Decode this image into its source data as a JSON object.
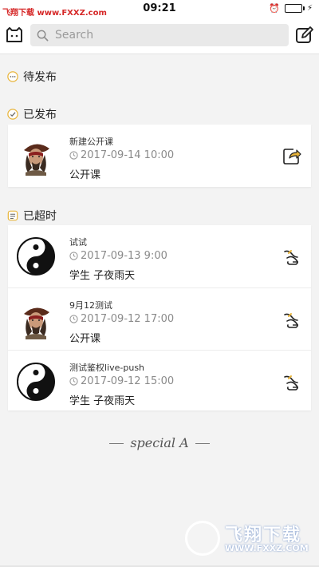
{
  "status_bar": {
    "watermark": "飞翔下载 www.FXXZ.com",
    "time": "09:21",
    "battery_percent": 100
  },
  "nav": {
    "search_placeholder": "Search",
    "left_icon": "cat-logo-icon",
    "right_icon": "compose-icon"
  },
  "sections": {
    "pending": {
      "label": "待发布",
      "icon": "pending-dots-icon"
    },
    "published": {
      "label": "已发布",
      "icon": "published-check-icon"
    },
    "expired": {
      "label": "已超时",
      "icon": "expired-list-icon"
    }
  },
  "published_items": [
    {
      "title": "新建公开课",
      "time": "2017-09-14 10:00",
      "sub": "公开课",
      "avatar": "pirate-avatar",
      "action_icon": "share-icon"
    }
  ],
  "expired_items": [
    {
      "title": "试试",
      "time": "2017-09-13 9:00",
      "sub": "学生 子夜雨天",
      "avatar": "yin-yang-avatar",
      "action_icon": "replay-icon"
    },
    {
      "title": "9月12测试",
      "time": "2017-09-12 17:00",
      "sub": "公开课",
      "avatar": "pirate-avatar",
      "action_icon": "replay-icon"
    },
    {
      "title": "测试鉴权live-push",
      "time": "2017-09-12 15:00",
      "sub": "学生 子夜雨天",
      "avatar": "yin-yang-avatar",
      "action_icon": "replay-icon"
    }
  ],
  "footer": {
    "brand": "special A"
  },
  "watermark_badge": {
    "title": "飞翔下载",
    "url": "WWW.FXXZ.COM"
  },
  "colors": {
    "accent": "#e8b43a",
    "watermark_red": "#d62828",
    "battery_green": "#1aa260"
  }
}
